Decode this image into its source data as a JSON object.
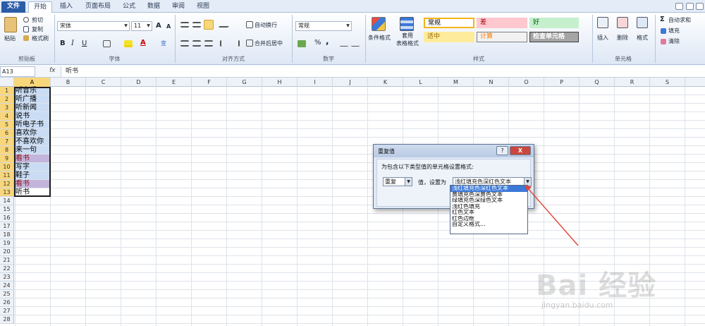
{
  "tabs": [
    "文件",
    "开始",
    "插入",
    "页面布局",
    "公式",
    "数据",
    "审阅",
    "视图"
  ],
  "ribbon": {
    "clipboard": {
      "paste": "粘贴",
      "cut": "剪切",
      "copy": "复制",
      "format_painter": "格式刷",
      "label": "剪贴板"
    },
    "font": {
      "name": "宋体",
      "size": "11",
      "grow": "A",
      "shrink": "A",
      "bold": "B",
      "italic": "I",
      "underline": "U",
      "font_color_letter": "A",
      "phonetic": "变",
      "label": "字体"
    },
    "alignment": {
      "wrap": "自动换行",
      "merge": "合并后居中",
      "label": "对齐方式"
    },
    "number": {
      "format": "常规",
      "percent": "%",
      "comma": ",",
      "label": "数字"
    },
    "styles": {
      "conditional": "条件格式",
      "table_format_1": "套用",
      "table_format_2": "表格格式",
      "cells": [
        {
          "text": "常规",
          "bg": "#ffffff",
          "color": "#000000",
          "border": "#f5b41d"
        },
        {
          "text": "差",
          "bg": "#ffc7ce",
          "color": "#9c0006",
          "border": "#ffc7ce"
        },
        {
          "text": "好",
          "bg": "#c6efce",
          "color": "#006100",
          "border": "#c6efce"
        },
        {
          "text": "适中",
          "bg": "#ffeb9c",
          "color": "#9c6500",
          "border": "#ffeb9c"
        },
        {
          "text": "计算",
          "bg": "#f2f2f2",
          "color": "#fa7d00",
          "border": "#7f7f7f"
        },
        {
          "text": "检查单元格",
          "bg": "#a5a5a5",
          "color": "#ffffff",
          "border": "#3f3f3f"
        }
      ],
      "label": "样式"
    },
    "cells_group": {
      "insert": "插入",
      "delete": "删除",
      "format": "格式",
      "label": "单元格"
    },
    "editing": {
      "autosum": "自动求和",
      "fill": "填充",
      "clear": "清除"
    }
  },
  "formula_bar": {
    "name_box": "A13",
    "fx": "fx",
    "formula": "听书"
  },
  "columns": [
    "A",
    "B",
    "C",
    "D",
    "E",
    "F",
    "G",
    "H",
    "I",
    "J",
    "K",
    "L",
    "M",
    "N",
    "O",
    "P",
    "Q",
    "R",
    "S"
  ],
  "rows": [
    "1",
    "2",
    "3",
    "4",
    "5",
    "6",
    "7",
    "8",
    "9",
    "10",
    "11",
    "12",
    "13",
    "14",
    "15",
    "16",
    "17",
    "18",
    "19",
    "20",
    "21",
    "22",
    "23",
    "24",
    "25",
    "26",
    "27",
    "28"
  ],
  "cells_a": [
    "听音乐",
    "听广播",
    "听新闻",
    "说书",
    "听电子书",
    "喜欢你",
    "不喜欢你",
    "来一句",
    "看书",
    "写字",
    "鞋子",
    "看书",
    "听书"
  ],
  "duplicate_rows": [
    9,
    12
  ],
  "dialog": {
    "title": "重复值",
    "help": "?",
    "close": "X",
    "prompt": "为包含以下类型值的单元格设置格式:",
    "type_value": "重复",
    "value_label": "值，设置为",
    "format_value": "浅红填充色深红色文本",
    "options": [
      "浅红填充色深红色文本",
      "黄填充色深黄色文本",
      "绿填充色深绿色文本",
      "浅红色填充",
      "红色文本",
      "红色边框",
      "自定义格式..."
    ]
  },
  "watermark": {
    "logo": "Bai 经验",
    "url": "jingyan.baidu.com"
  }
}
